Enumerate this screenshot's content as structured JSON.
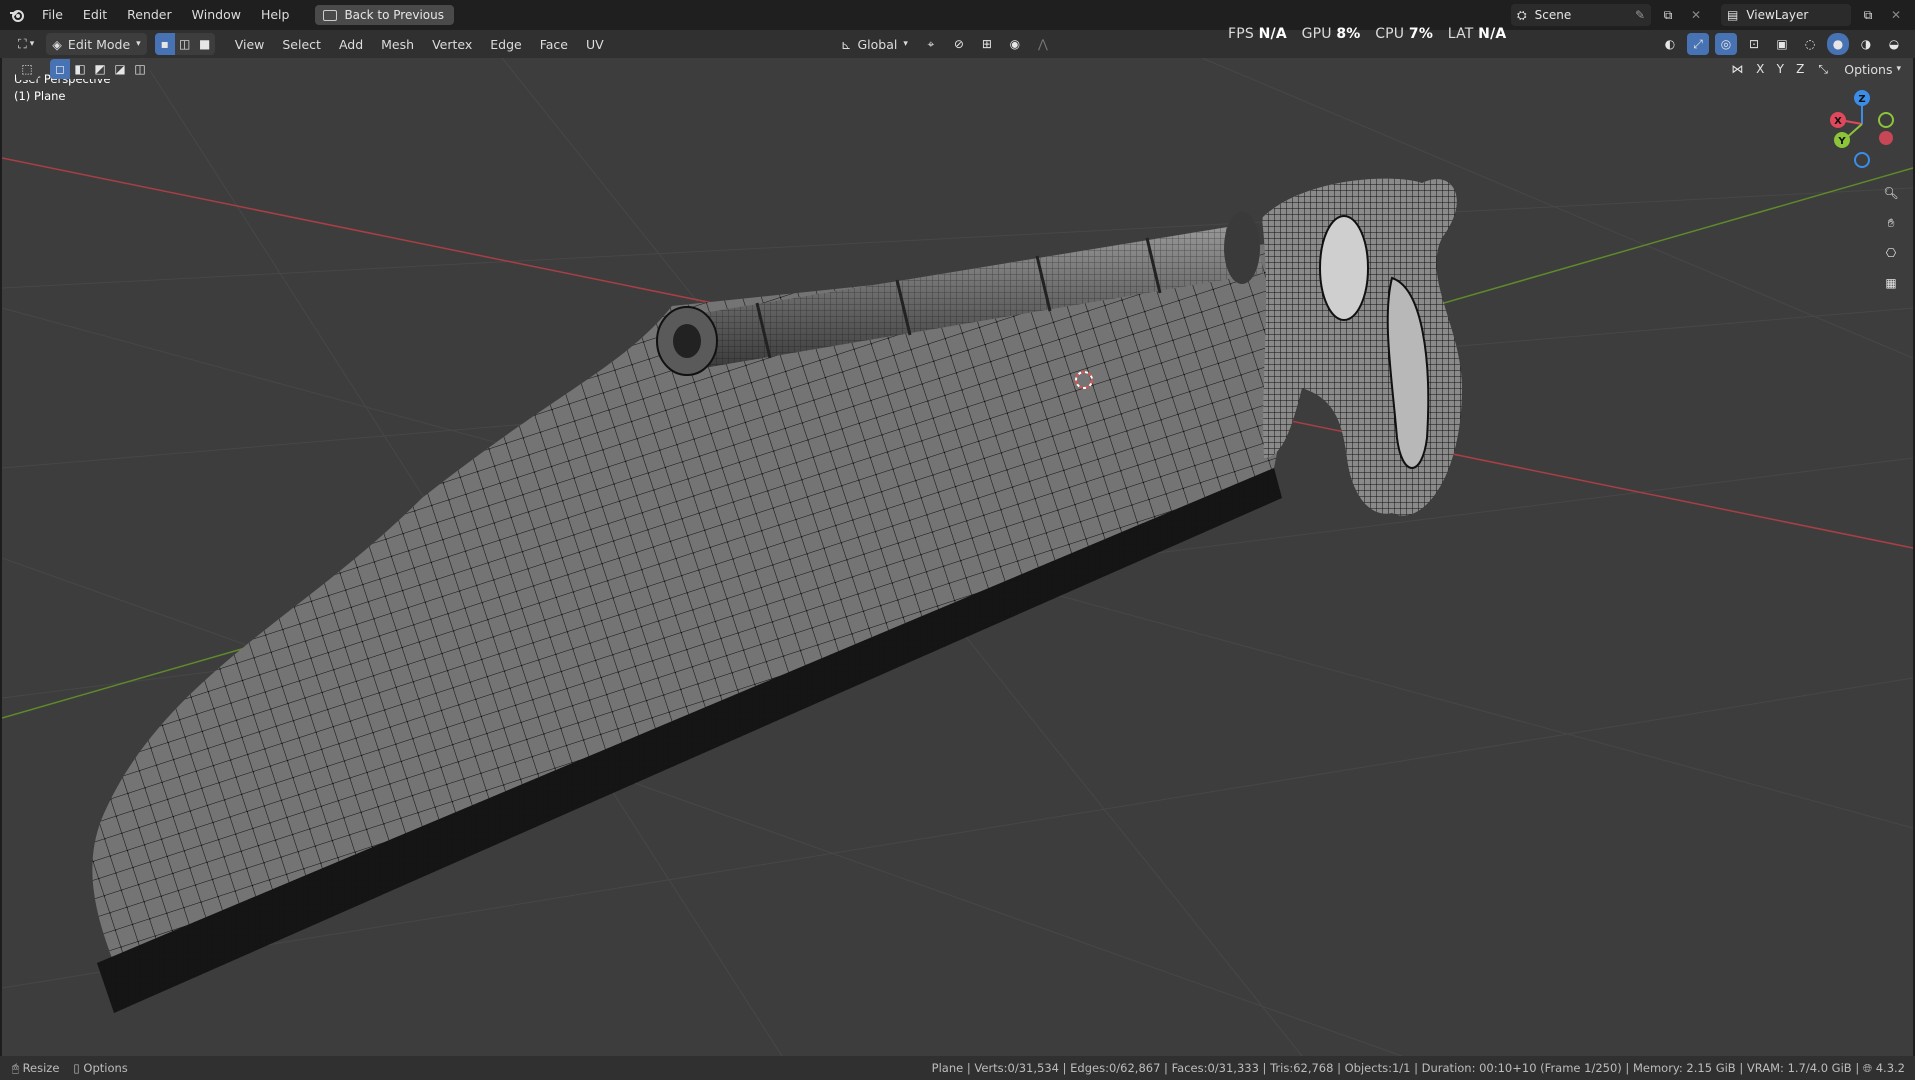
{
  "topbar": {
    "menus": [
      "File",
      "Edit",
      "Render",
      "Window",
      "Help"
    ],
    "back_button": "Back to Previous",
    "scene": "Scene",
    "view_layer": "ViewLayer"
  },
  "header": {
    "mode": "Edit Mode",
    "menus": [
      "View",
      "Select",
      "Add",
      "Mesh",
      "Vertex",
      "Edge",
      "Face",
      "UV"
    ],
    "transform_orientation": "Global",
    "options_label": "Options",
    "axes": [
      "X",
      "Y",
      "Z"
    ]
  },
  "stats_overlay": {
    "fps_label": "FPS",
    "fps_value": "N/A",
    "gpu_label": "GPU",
    "gpu_value": "8%",
    "cpu_label": "CPU",
    "cpu_value": "7%",
    "lat_label": "LAT",
    "lat_value": "N/A"
  },
  "viewport": {
    "perspective_label": "User Perspective",
    "object_label": "(1) Plane",
    "gizmo_axes": [
      "X",
      "Y",
      "Z"
    ]
  },
  "statusbar": {
    "resize_label": "Resize",
    "options_label": "Options",
    "info": "Plane | Verts:0/31,534 | Edges:0/62,867 | Faces:0/31,333 | Tris:62,768 | Objects:1/1 | Duration: 00:10+10 (Frame 1/250) | Memory: 2.15 GiB | VRAM: 1.7/4.0 GiB | ",
    "version": "4.3.2"
  },
  "colors": {
    "accent": "#4772b3",
    "viewport_bg": "#3d3d3d",
    "axis_x": "#e0495b",
    "axis_y": "#8cc43a",
    "axis_z": "#3b8de8"
  }
}
